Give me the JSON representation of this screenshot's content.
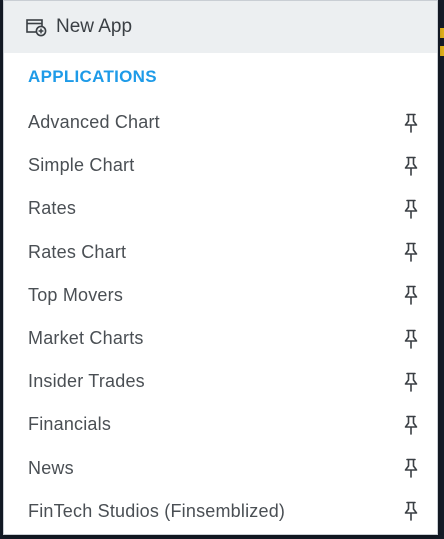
{
  "menu": {
    "new_app": {
      "label": "New App",
      "icon": "new-window-plus-icon"
    },
    "section_title": "APPLICATIONS",
    "items": [
      {
        "label": "Advanced Chart",
        "icon": "pin-icon"
      },
      {
        "label": "Simple Chart",
        "icon": "pin-icon"
      },
      {
        "label": "Rates",
        "icon": "pin-icon"
      },
      {
        "label": "Rates Chart",
        "icon": "pin-icon"
      },
      {
        "label": "Top Movers",
        "icon": "pin-icon"
      },
      {
        "label": "Market Charts",
        "icon": "pin-icon"
      },
      {
        "label": "Insider Trades",
        "icon": "pin-icon"
      },
      {
        "label": "Financials",
        "icon": "pin-icon"
      },
      {
        "label": "News",
        "icon": "pin-icon"
      },
      {
        "label": "FinTech Studios (Finsemblized)",
        "icon": "pin-icon"
      }
    ]
  },
  "colors": {
    "accent": "#1e9be8",
    "header_bg": "#eceff1",
    "text": "#4a4f54",
    "icon": "#3a3f44"
  }
}
